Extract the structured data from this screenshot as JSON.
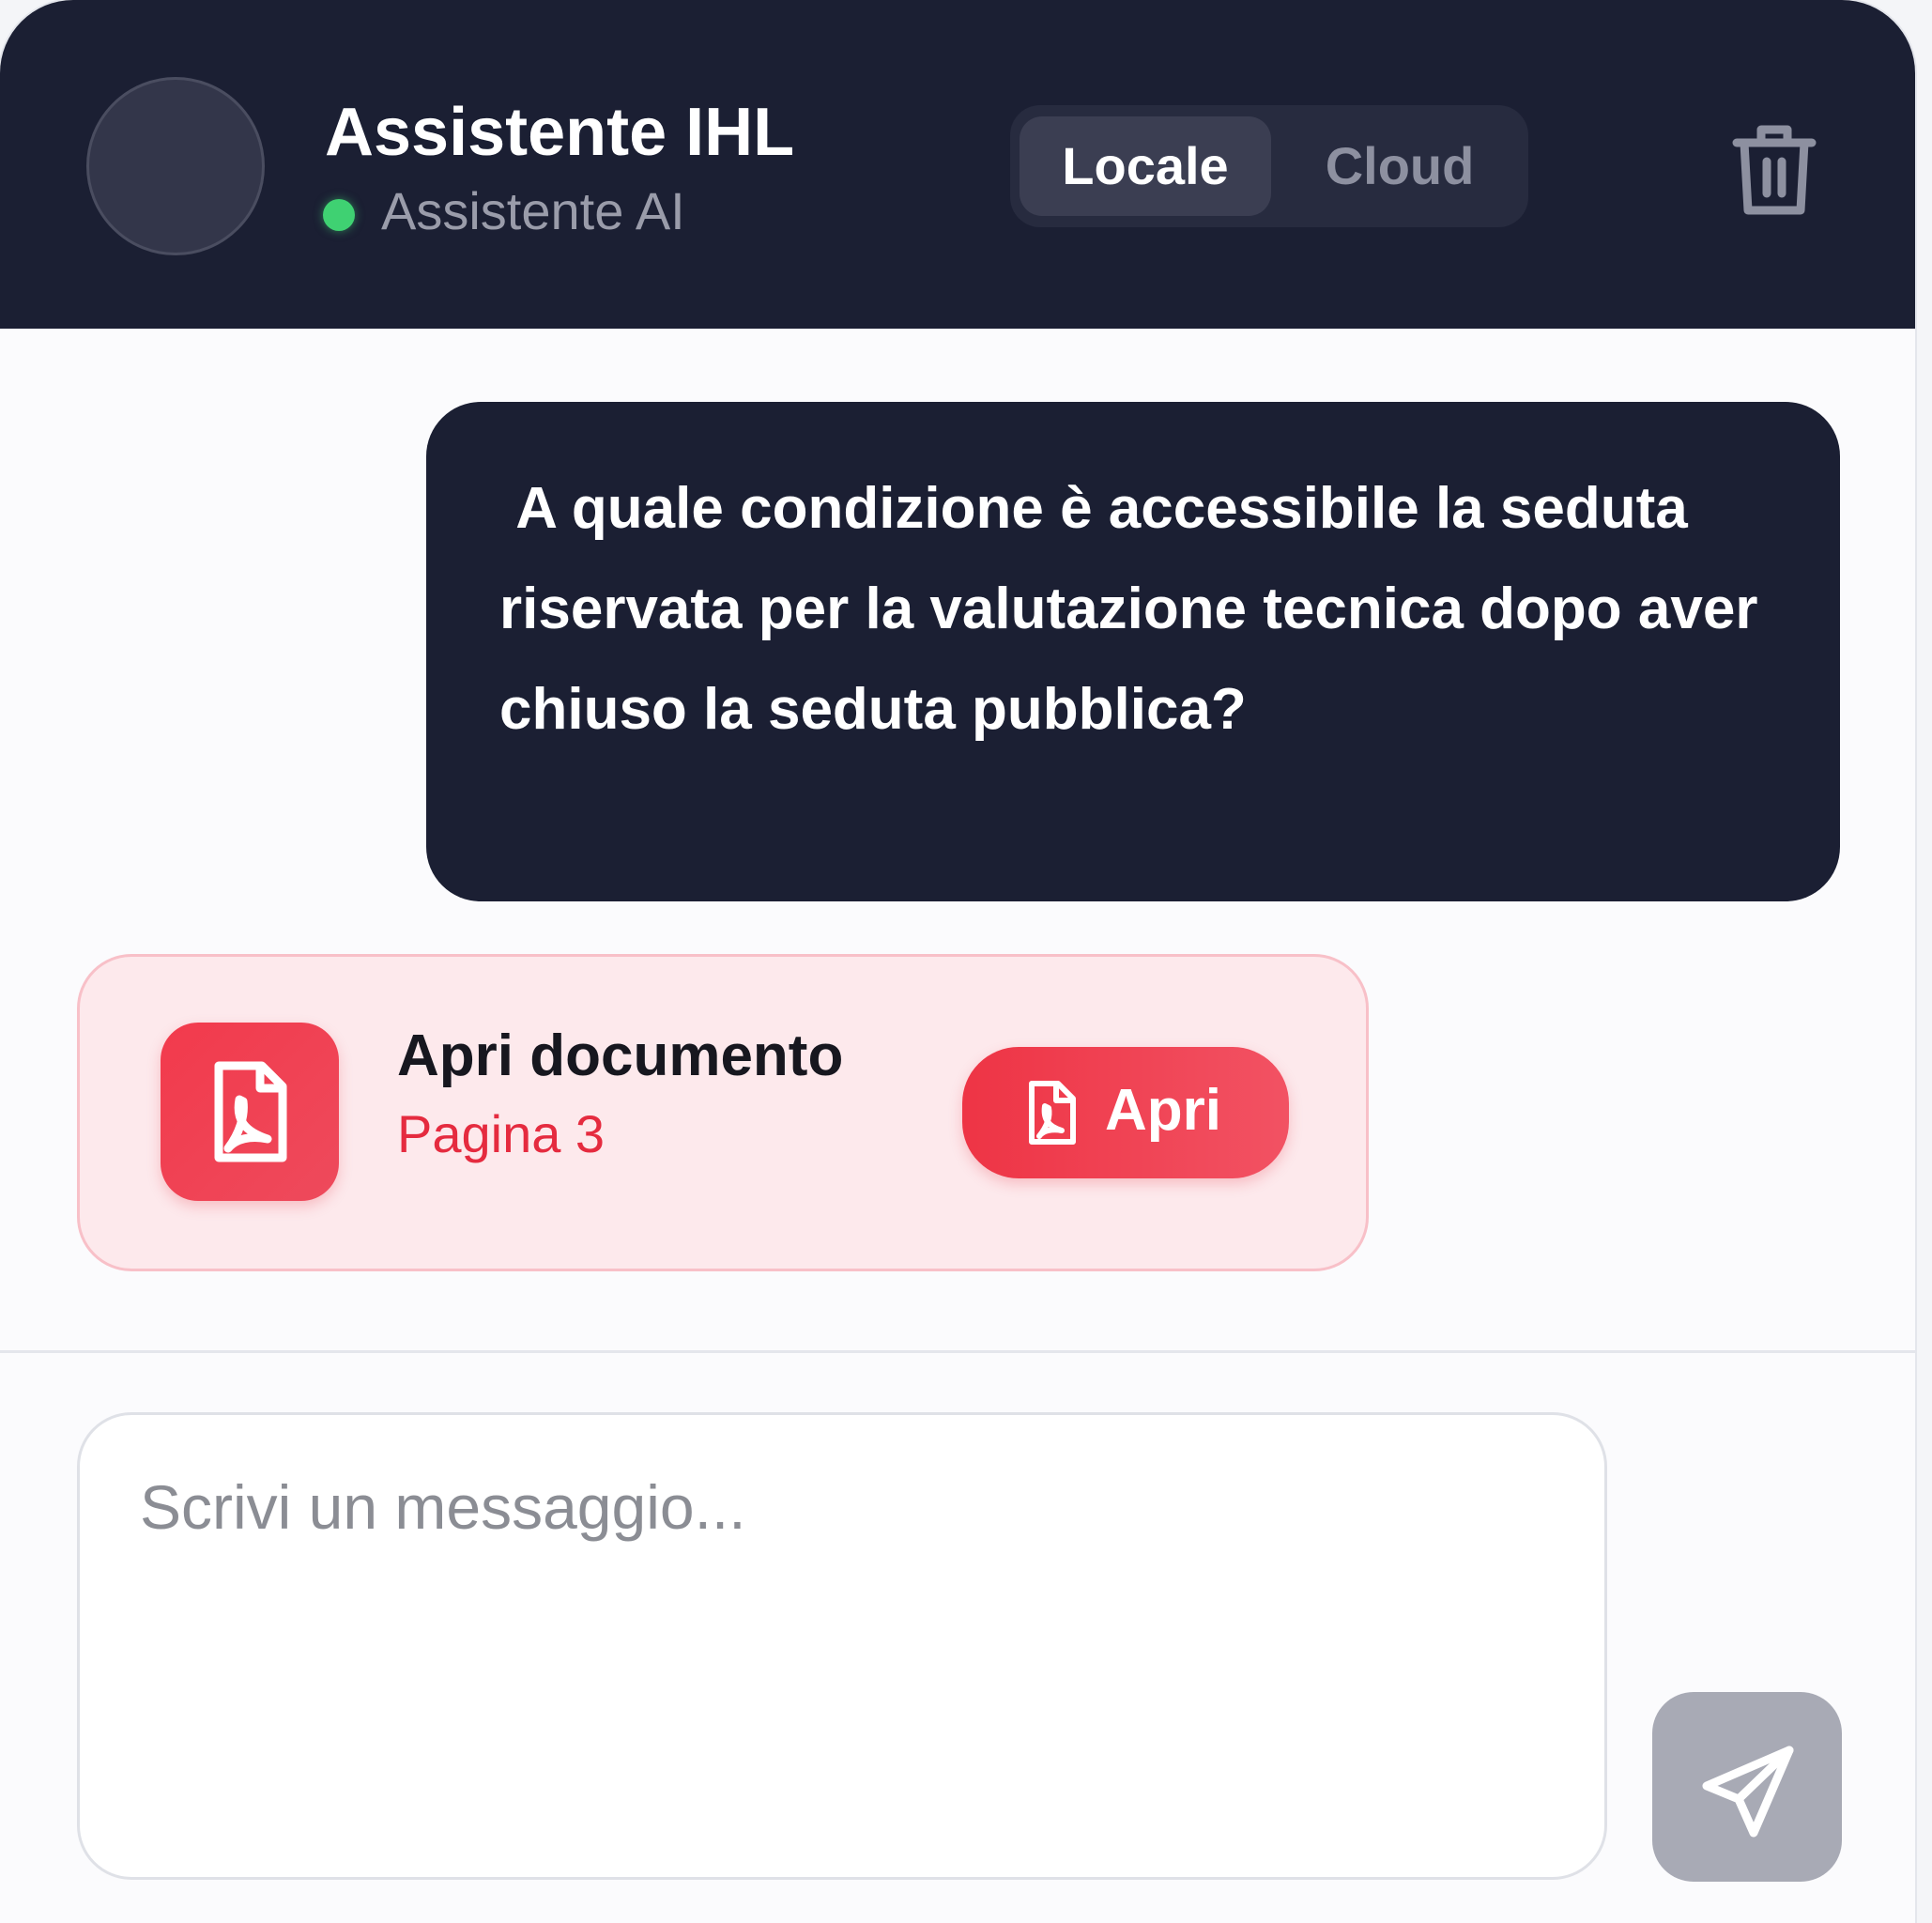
{
  "header": {
    "title": "Assistente IHL",
    "subtitle": "Assistente AI",
    "status_color": "#3fd172",
    "mode_toggle": {
      "options": [
        "Locale",
        "Cloud"
      ],
      "selected": "Locale"
    },
    "trash_icon": "trash-icon"
  },
  "messages": {
    "user_message": " A quale condizione è accessibile la seduta riservata per la valutazione tecnica dopo aver chiuso la seduta pubblica?",
    "doc_card": {
      "title": "Apri documento",
      "page": "Pagina 3",
      "button_label": "Apri",
      "icon": "pdf-file-icon"
    }
  },
  "composer": {
    "placeholder": "Scrivi un messaggio...",
    "value": ""
  },
  "send_icon": "send-icon",
  "colors": {
    "header_bg": "#1b1f33",
    "accent_red": "#ee3445",
    "card_bg": "#fde9ec",
    "send_bg": "#a8aab5"
  }
}
